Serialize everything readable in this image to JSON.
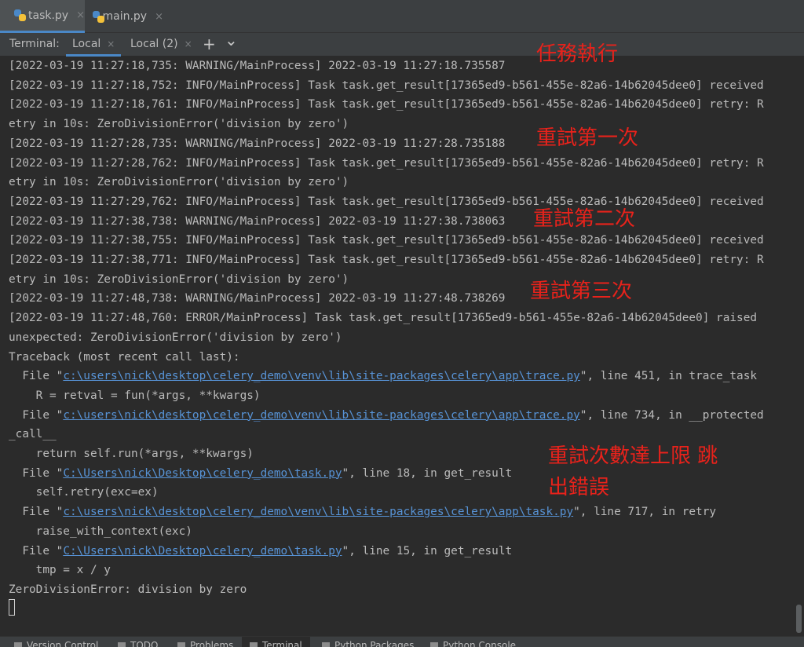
{
  "editor_tabs": [
    {
      "label": "task.py",
      "close": "×",
      "icon": "python-file-icon",
      "active": true
    },
    {
      "label": "main.py",
      "close": "×",
      "icon": "python-file-icon",
      "active": false
    }
  ],
  "terminal": {
    "title": "Terminal:",
    "tabs": [
      {
        "label": "Local",
        "close": "×",
        "active": true
      },
      {
        "label": "Local (2)",
        "close": "×",
        "active": false
      }
    ],
    "add": "+",
    "dropdown": "⌄"
  },
  "console": {
    "lines": [
      "[2022-03-19 11:27:18,735: WARNING/MainProcess] 2022-03-19 11:27:18.735587",
      "[2022-03-19 11:27:18,752: INFO/MainProcess] Task task.get_result[17365ed9-b561-455e-82a6-14b62045dee0] received",
      "[2022-03-19 11:27:18,761: INFO/MainProcess] Task task.get_result[17365ed9-b561-455e-82a6-14b62045dee0] retry: R",
      "etry in 10s: ZeroDivisionError('division by zero')",
      "[2022-03-19 11:27:28,735: WARNING/MainProcess] 2022-03-19 11:27:28.735188",
      "[2022-03-19 11:27:28,762: INFO/MainProcess] Task task.get_result[17365ed9-b561-455e-82a6-14b62045dee0] retry: R",
      "etry in 10s: ZeroDivisionError('division by zero')",
      "[2022-03-19 11:27:29,762: INFO/MainProcess] Task task.get_result[17365ed9-b561-455e-82a6-14b62045dee0] received",
      "[2022-03-19 11:27:38,738: WARNING/MainProcess] 2022-03-19 11:27:38.738063",
      "[2022-03-19 11:27:38,755: INFO/MainProcess] Task task.get_result[17365ed9-b561-455e-82a6-14b62045dee0] received",
      "[2022-03-19 11:27:38,771: INFO/MainProcess] Task task.get_result[17365ed9-b561-455e-82a6-14b62045dee0] retry: R",
      "etry in 10s: ZeroDivisionError('division by zero')",
      "[2022-03-19 11:27:48,738: WARNING/MainProcess] 2022-03-19 11:27:48.738269",
      "[2022-03-19 11:27:48,760: ERROR/MainProcess] Task task.get_result[17365ed9-b561-455e-82a6-14b62045dee0] raised",
      "unexpected: ZeroDivisionError('division by zero')",
      "Traceback (most recent call last):"
    ],
    "traceback": [
      {
        "prefix": "  File \"",
        "link": "c:\\users\\nick\\desktop\\celery_demo\\venv\\lib\\site-packages\\celery\\app\\trace.py",
        "suffix": "\", line 451, in trace_task"
      },
      {
        "text": "    R = retval = fun(*args, **kwargs)"
      },
      {
        "prefix": "  File \"",
        "link": "c:\\users\\nick\\desktop\\celery_demo\\venv\\lib\\site-packages\\celery\\app\\trace.py",
        "suffix": "\", line 734, in __protected"
      },
      {
        "text": "_call__"
      },
      {
        "text": "    return self.run(*args, **kwargs)"
      },
      {
        "prefix": "  File \"",
        "link": "C:\\Users\\nick\\Desktop\\celery_demo\\task.py",
        "suffix": "\", line 18, in get_result"
      },
      {
        "text": "    self.retry(exc=ex)"
      },
      {
        "prefix": "  File \"",
        "link": "c:\\users\\nick\\desktop\\celery_demo\\venv\\lib\\site-packages\\celery\\app\\task.py",
        "suffix": "\", line 717, in retry"
      },
      {
        "text": "    raise_with_context(exc)"
      },
      {
        "prefix": "  File \"",
        "link": "C:\\Users\\nick\\Desktop\\celery_demo\\task.py",
        "suffix": "\", line 15, in get_result"
      },
      {
        "text": "    tmp = x / y"
      },
      {
        "text": "ZeroDivisionError: division by zero"
      }
    ]
  },
  "annotations": {
    "execute": "任務執行",
    "retry1": "重試第一次",
    "retry2": "重試第二次",
    "retry3": "重試第三次",
    "limit_line1": "重試次數達上限 跳",
    "limit_line2": "出錯誤",
    "color": "#e8221b"
  },
  "bottom_tools": [
    {
      "label": "Version Control",
      "icon": "branch-icon"
    },
    {
      "label": "TODO",
      "icon": "list-icon"
    },
    {
      "label": "Problems",
      "icon": "warning-icon"
    },
    {
      "label": "Terminal",
      "icon": "terminal-icon",
      "active": true
    },
    {
      "label": "Python Packages",
      "icon": "package-icon"
    },
    {
      "label": "Python Console",
      "icon": "python-icon"
    }
  ]
}
